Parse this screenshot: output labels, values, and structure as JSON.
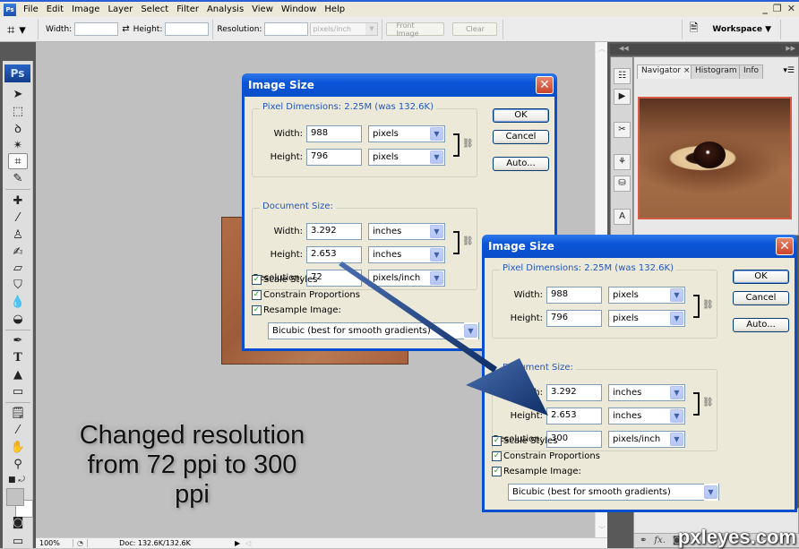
{
  "menubar": {
    "items": [
      "File",
      "Edit",
      "Image",
      "Layer",
      "Select",
      "Filter",
      "Analysis",
      "View",
      "Window",
      "Help"
    ],
    "window_controls": [
      "_",
      "❐",
      "✕"
    ]
  },
  "options_bar": {
    "width_label": "Width:",
    "height_label": "Height:",
    "resolution_label": "Resolution:",
    "resolution_unit": "pixels/inch",
    "front_image_label": "Front Image",
    "clear_label": "Clear",
    "workspace_label": "Workspace ▼"
  },
  "tools": {
    "logo": "Ps"
  },
  "caption": {
    "line1": "Changed resolution",
    "line2": "from 72 ppi to 300",
    "line3": "ppi"
  },
  "statusbar": {
    "zoom": "100%",
    "doc": "Doc: 132.6K/132.6K"
  },
  "panels": {
    "tabs": [
      "Navigator ×",
      "Histogram",
      "Info"
    ],
    "watermark": "pxleyes.com"
  },
  "dialog_before": {
    "title": "Image Size",
    "pixel_dimensions_label": "Pixel Dimensions:  2.25M (was 132.6K)",
    "px_width_label": "Width:",
    "px_width": "988",
    "px_width_unit": "pixels",
    "px_height_label": "Height:",
    "px_height": "796",
    "px_height_unit": "pixels",
    "document_size_label": "Document Size:",
    "doc_width_label": "Width:",
    "doc_width": "3.292",
    "doc_width_unit": "inches",
    "doc_height_label": "Height:",
    "doc_height": "2.653",
    "doc_height_unit": "inches",
    "resolution_label": "Resolution:",
    "resolution": "72",
    "resolution_unit": "pixels/inch",
    "ok_label": "OK",
    "cancel_label": "Cancel",
    "auto_label": "Auto...",
    "scale_styles": "Scale Styles",
    "constrain": "Constrain Proportions",
    "resample": "Resample Image:",
    "resample_method": "Bicubic (best for smooth gradients)"
  },
  "dialog_after": {
    "title": "Image Size",
    "pixel_dimensions_label": "Pixel Dimensions:  2.25M (was 132.6K)",
    "px_width_label": "Width:",
    "px_width": "988",
    "px_width_unit": "pixels",
    "px_height_label": "Height:",
    "px_height": "796",
    "px_height_unit": "pixels",
    "document_size_label": "Document Size:",
    "doc_width_label": "Width:",
    "doc_width": "3.292",
    "doc_width_unit": "inches",
    "doc_height_label": "Height:",
    "doc_height": "2.653",
    "doc_height_unit": "inches",
    "resolution_label": "Resolution:",
    "resolution": "300",
    "resolution_unit": "pixels/inch",
    "ok_label": "OK",
    "cancel_label": "Cancel",
    "auto_label": "Auto...",
    "scale_styles": "Scale Styles",
    "constrain": "Constrain Proportions",
    "resample": "Resample Image:",
    "resample_method": "Bicubic (best for smooth gradients)"
  },
  "colors": {
    "dialog_title": "#0a4ed0",
    "group_title": "#1f55c4",
    "check": "#21a121",
    "arrow": "#1b3f7a"
  }
}
